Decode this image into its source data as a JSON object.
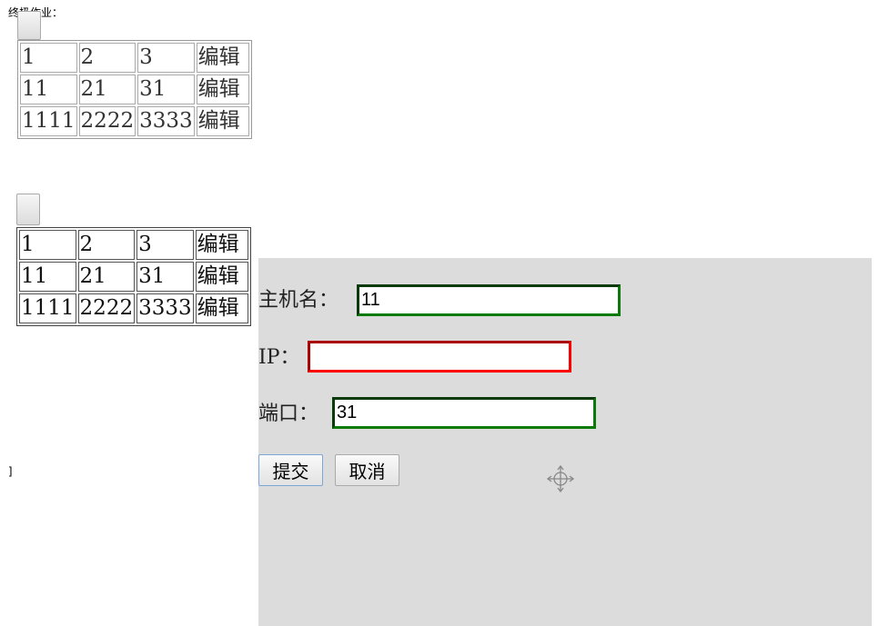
{
  "page_title": "终极作业：",
  "tables": [
    {
      "rows": [
        [
          "1",
          "2",
          "3",
          "编辑"
        ],
        [
          "11",
          "21",
          "31",
          "编辑"
        ],
        [
          "1111",
          "2222",
          "3333",
          "编辑"
        ]
      ]
    },
    {
      "rows": [
        [
          "1",
          "2",
          "3",
          "编辑"
        ],
        [
          "11",
          "21",
          "31",
          "编辑"
        ],
        [
          "1111",
          "2222",
          "3333",
          "编辑"
        ]
      ]
    }
  ],
  "stray_text": "]",
  "form": {
    "hostname_label": "主机名：",
    "hostname_value": "11",
    "ip_label": "IP：",
    "ip_value": "",
    "port_label": "端口：",
    "port_value": "31",
    "submit_label": "提交",
    "cancel_label": "取消"
  },
  "colors": {
    "valid": "#0a7a0a",
    "invalid": "#ff0000",
    "overlay": "#dcdcdc"
  }
}
